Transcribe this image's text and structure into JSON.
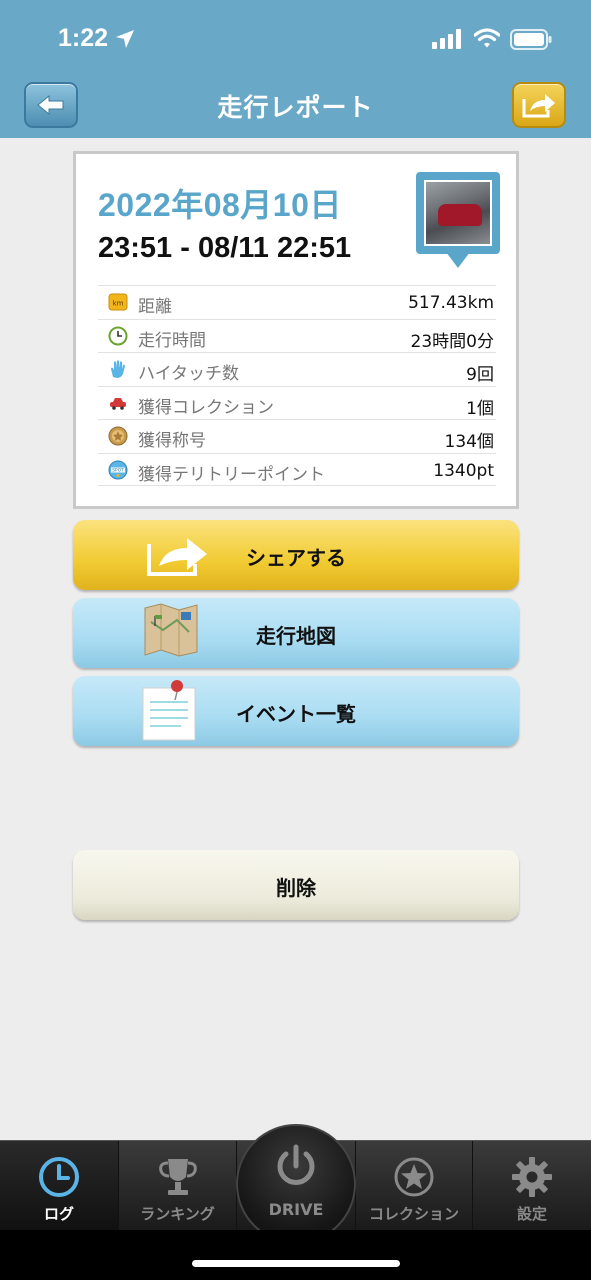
{
  "status_bar": {
    "time": "1:22"
  },
  "header": {
    "title": "走行レポート"
  },
  "report": {
    "date": "2022年08月10日",
    "time_range": "23:51 - 08/11 22:51",
    "rows": [
      {
        "icon": "km-icon",
        "label": "距離",
        "value": "517.43km"
      },
      {
        "icon": "clock-icon",
        "label": "走行時間",
        "value": "23時間0分"
      },
      {
        "icon": "hand-icon",
        "label": "ハイタッチ数",
        "value": "9回"
      },
      {
        "icon": "car-icon",
        "label": "獲得コレクション",
        "value": "1個"
      },
      {
        "icon": "medal-icon",
        "label": "獲得称号",
        "value": "134個"
      },
      {
        "icon": "spot-icon",
        "label": "獲得テリトリーポイント",
        "value": "1340pt"
      }
    ]
  },
  "actions": {
    "share": "シェアする",
    "map": "走行地図",
    "events": "イベント一覧",
    "delete": "削除"
  },
  "tabbar": {
    "log": "ログ",
    "ranking": "ランキング",
    "drive": "DRIVE",
    "collection": "コレクション",
    "settings": "設定"
  },
  "colors": {
    "header": "#6aa8c8",
    "date": "#5aa6cb",
    "share_button": "#f1cb32",
    "blue_button": "#a9dcf2",
    "active_tab": "#5ab4e6"
  }
}
